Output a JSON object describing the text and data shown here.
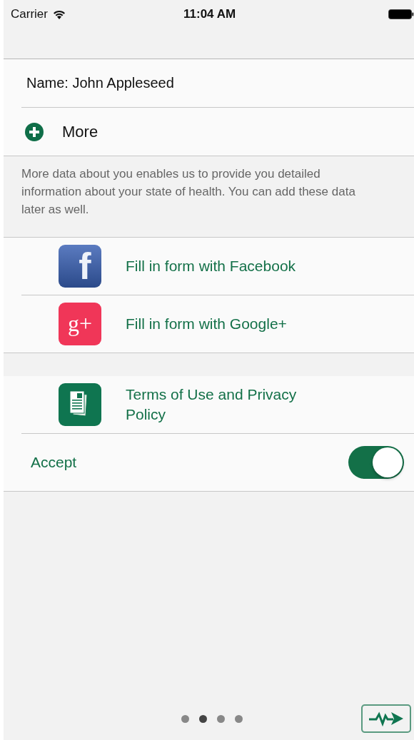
{
  "status_bar": {
    "carrier": "Carrier",
    "time": "11:04 AM"
  },
  "name_row": {
    "label": "Name:",
    "value": "John Appleseed"
  },
  "more_row": {
    "label": "More"
  },
  "footnote": "More data about you enables us to provide you detailed information about your state of health. You can add these data later as well.",
  "social_buttons": [
    {
      "kind": "facebook",
      "glyph": "f",
      "label": "Fill in form with Facebook"
    },
    {
      "kind": "google",
      "glyph": "g+",
      "label": "Fill in form with Google+"
    }
  ],
  "terms": {
    "label": "Terms of Use and Privacy Policy"
  },
  "accept": {
    "label": "Accept",
    "on": true
  },
  "page_dots": [
    {
      "selected": false
    },
    {
      "selected": true
    },
    {
      "selected": false
    },
    {
      "selected": false
    }
  ]
}
